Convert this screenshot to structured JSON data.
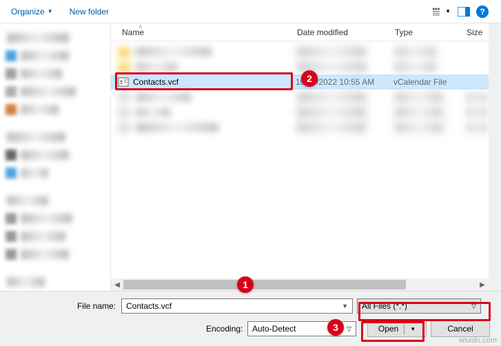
{
  "toolbar": {
    "organize": "Organize",
    "new_folder": "New folder"
  },
  "headers": {
    "name": "Name",
    "date": "Date modified",
    "type": "Type",
    "size": "Size"
  },
  "selected_file": {
    "name": "Contacts.vcf",
    "date": "10/25/2022 10:55 AM",
    "type": "vCalendar File"
  },
  "bottom": {
    "filename_label": "File name:",
    "filename_value": "Contacts.vcf",
    "filter_value": "All Files  (*.*)",
    "encoding_label": "Encoding:",
    "encoding_value": "Auto-Detect",
    "open": "Open",
    "cancel": "Cancel"
  },
  "callouts": {
    "c1": "1",
    "c2": "2",
    "c3": "3"
  },
  "watermark": "wsxdn.com"
}
